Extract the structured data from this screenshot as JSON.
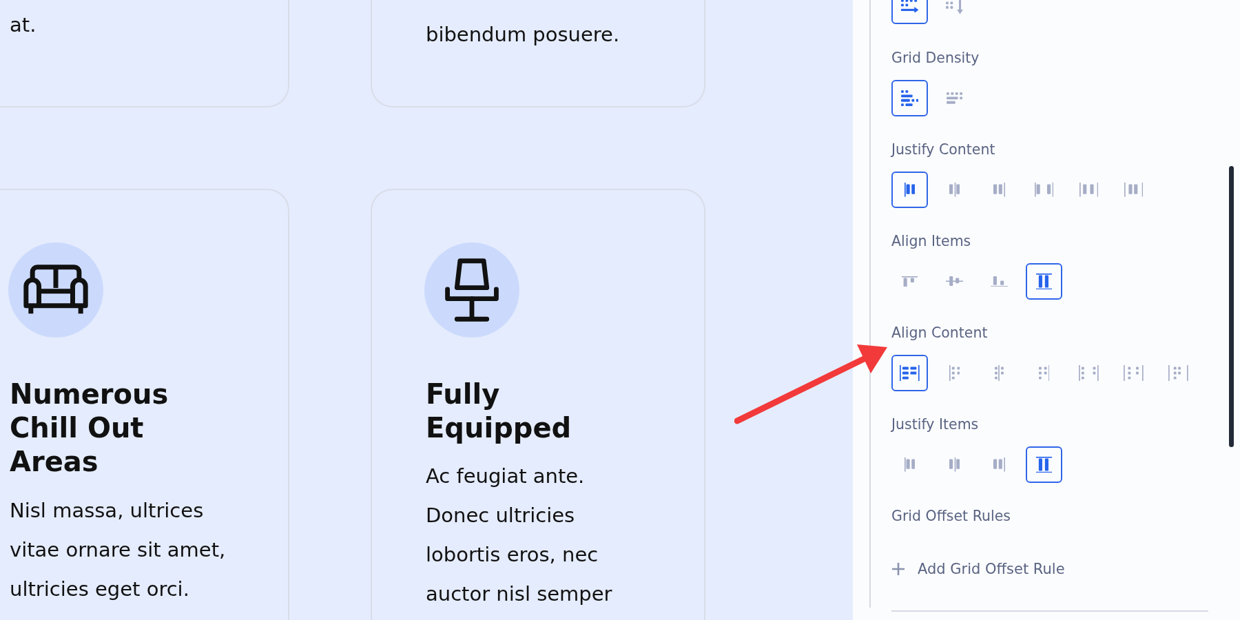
{
  "canvas": {
    "cards_top": [
      {
        "text": "at."
      },
      {
        "text": "bibendum posuere."
      }
    ],
    "cards": [
      {
        "kind": "sofa",
        "title_lines": [
          "Numerous",
          "Chill Out",
          "Areas"
        ],
        "body_lines": [
          "Nisl massa, ultrices",
          "vitae ornare sit amet,",
          "ultricies eget orci."
        ]
      },
      {
        "kind": "chair",
        "title_lines": [
          "Fully",
          "Equipped"
        ],
        "body_lines": [
          "Ac feugiat ante.",
          "Donec ultricies",
          "lobortis eros, nec",
          "auctor nisl semper"
        ]
      }
    ]
  },
  "panel": {
    "groups": [
      {
        "kind": "flow",
        "options": [
          {
            "kind": "row",
            "selected": true
          },
          {
            "kind": "column",
            "selected": false
          }
        ]
      },
      {
        "label": "Grid Density",
        "kind": "density",
        "options": [
          {
            "kind": "sparse",
            "selected": true
          },
          {
            "kind": "dense",
            "selected": false
          }
        ]
      },
      {
        "label": "Justify Content",
        "kind": "justify",
        "options": [
          {
            "kind": "start",
            "selected": true
          },
          {
            "kind": "center",
            "selected": false
          },
          {
            "kind": "end",
            "selected": false
          },
          {
            "kind": "space-between",
            "selected": false
          },
          {
            "kind": "space-around",
            "selected": false
          },
          {
            "kind": "space-evenly",
            "selected": false
          }
        ]
      },
      {
        "label": "Align Items",
        "kind": "align",
        "options": [
          {
            "kind": "start",
            "selected": false
          },
          {
            "kind": "center",
            "selected": false
          },
          {
            "kind": "end",
            "selected": false
          },
          {
            "kind": "stretch",
            "selected": true
          }
        ]
      },
      {
        "label": "Align Content",
        "kind": "dots",
        "options": [
          {
            "kind": "stretch",
            "selected": true
          },
          {
            "kind": "start",
            "selected": false
          },
          {
            "kind": "center",
            "selected": false
          },
          {
            "kind": "end",
            "selected": false
          },
          {
            "kind": "space-between",
            "selected": false
          },
          {
            "kind": "space-around",
            "selected": false
          },
          {
            "kind": "space-evenly",
            "selected": false
          }
        ]
      },
      {
        "label": "Justify Items",
        "kind": "justify",
        "options": [
          {
            "kind": "start",
            "selected": false
          },
          {
            "kind": "center",
            "selected": false
          },
          {
            "kind": "end",
            "selected": false
          },
          {
            "kind": "stretch",
            "selected": true
          }
        ]
      },
      {
        "label": "Grid Offset Rules"
      }
    ],
    "add_rule": {
      "label": "Add Grid Offset Rule"
    }
  }
}
